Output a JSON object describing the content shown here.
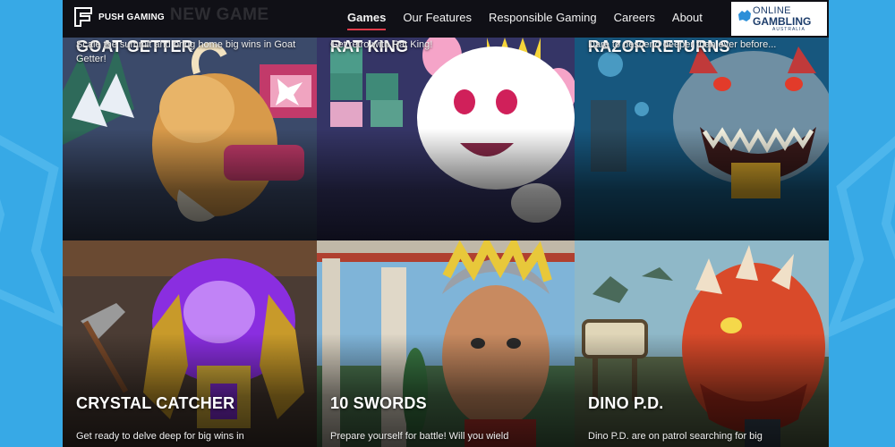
{
  "brand": {
    "logo_text": "PUSH GAMING",
    "ghost_heading": "NEW GAME"
  },
  "nav": [
    {
      "label": "Games",
      "active": true
    },
    {
      "label": "Our Features",
      "active": false
    },
    {
      "label": "Responsible Gaming",
      "active": false
    },
    {
      "label": "Careers",
      "active": false
    },
    {
      "label": "About",
      "active": false
    }
  ],
  "badge": {
    "line1": "ONLINE",
    "line2": "GAMBLING",
    "line3": "AUSTRALIA"
  },
  "games": [
    {
      "title": "GOAT GETTER",
      "description": "Scale the summit and bring home big wins in Goat Getter!",
      "art": "goat-icon"
    },
    {
      "title": "RAT KING",
      "description": "Get retro with Rat King!",
      "art": "rat-icon"
    },
    {
      "title": "RAZOR RETURNS",
      "description": "Dare to descend deeper than ever before...",
      "art": "shark-icon"
    },
    {
      "title": "CRYSTAL CATCHER",
      "description": "Get ready to delve deep for big wins in",
      "art": "crystal-icon"
    },
    {
      "title": "10 SWORDS",
      "description": "Prepare yourself for battle! Will you wield",
      "art": "emperor-icon"
    },
    {
      "title": "DINO P.D.",
      "description": "Dino P.D. are on patrol searching for big",
      "art": "dino-icon"
    }
  ],
  "colors": {
    "page_background": "#37a9e6",
    "site_background": "#16161c",
    "nav_active_underline": "#e23b4a",
    "badge_text": "#1d3d6b"
  }
}
